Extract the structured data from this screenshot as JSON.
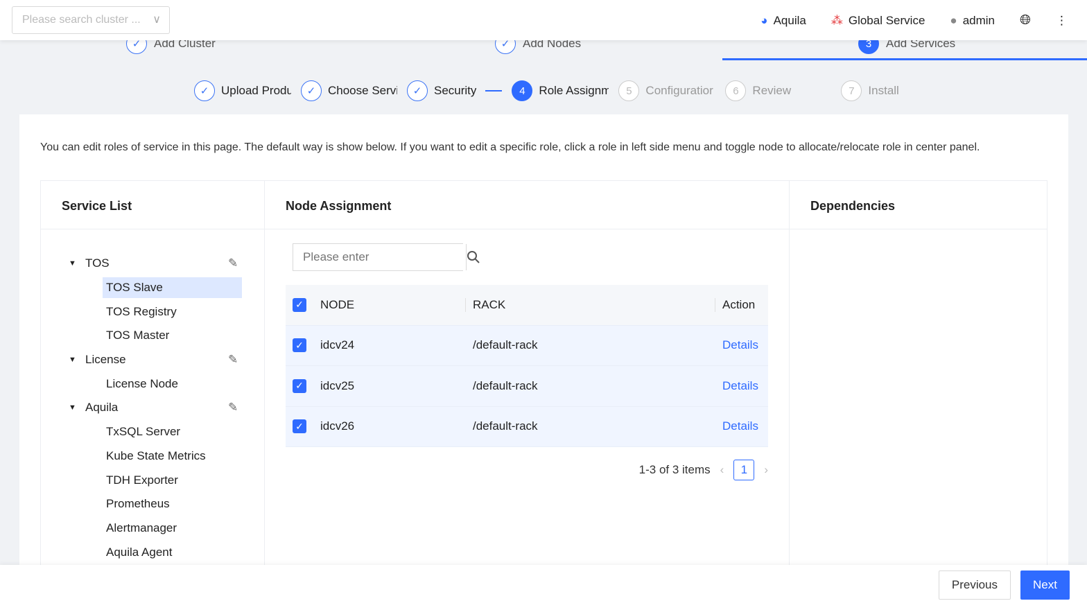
{
  "header": {
    "cluster_search_placeholder": "Please search cluster ...",
    "aquila": "Aquila",
    "global_service": "Global Service",
    "user": "admin"
  },
  "main_steps": [
    {
      "label": "Add Cluster",
      "state": "done"
    },
    {
      "label": "Add Nodes",
      "state": "done"
    },
    {
      "label": "Add Services",
      "num": "3",
      "state": "active"
    }
  ],
  "sub_steps": [
    {
      "label": "Upload Produ",
      "state": "done"
    },
    {
      "label": "Choose Servi",
      "state": "done"
    },
    {
      "label": "Security",
      "state": "done"
    },
    {
      "label": "Role Assignm",
      "num": "4",
      "state": "active"
    },
    {
      "label": "Configuratior",
      "num": "5",
      "state": "todo"
    },
    {
      "label": "Review",
      "num": "6",
      "state": "todo"
    },
    {
      "label": "Install",
      "num": "7",
      "state": "todo"
    }
  ],
  "description": "You can edit roles of service in this page. The default way is show below. If you want to edit a specific role, click a role in left side menu and toggle node to allocate/relocate role in center panel.",
  "service_list": {
    "title": "Service List",
    "groups": [
      {
        "name": "TOS",
        "roles": [
          "TOS Slave",
          "TOS Registry",
          "TOS Master"
        ]
      },
      {
        "name": "License",
        "roles": [
          "License Node"
        ]
      },
      {
        "name": "Aquila",
        "roles": [
          "TxSQL Server",
          "Kube State Metrics",
          "TDH Exporter",
          "Prometheus",
          "Alertmanager",
          "Aquila Agent"
        ]
      }
    ],
    "selected": "TOS Slave"
  },
  "node_assignment": {
    "title": "Node Assignment",
    "search_placeholder": "Please enter",
    "columns": [
      "NODE",
      "RACK",
      "Action"
    ],
    "rows": [
      {
        "node": "idcv24",
        "rack": "/default-rack",
        "action": "Details",
        "checked": true
      },
      {
        "node": "idcv25",
        "rack": "/default-rack",
        "action": "Details",
        "checked": true
      },
      {
        "node": "idcv26",
        "rack": "/default-rack",
        "action": "Details",
        "checked": true
      }
    ],
    "pagination": {
      "summary": "1-3 of 3 items",
      "page": "1"
    }
  },
  "dependencies": {
    "title": "Dependencies"
  },
  "footer": {
    "previous": "Previous",
    "next": "Next"
  },
  "colors": {
    "accent": "#2f6bff"
  }
}
